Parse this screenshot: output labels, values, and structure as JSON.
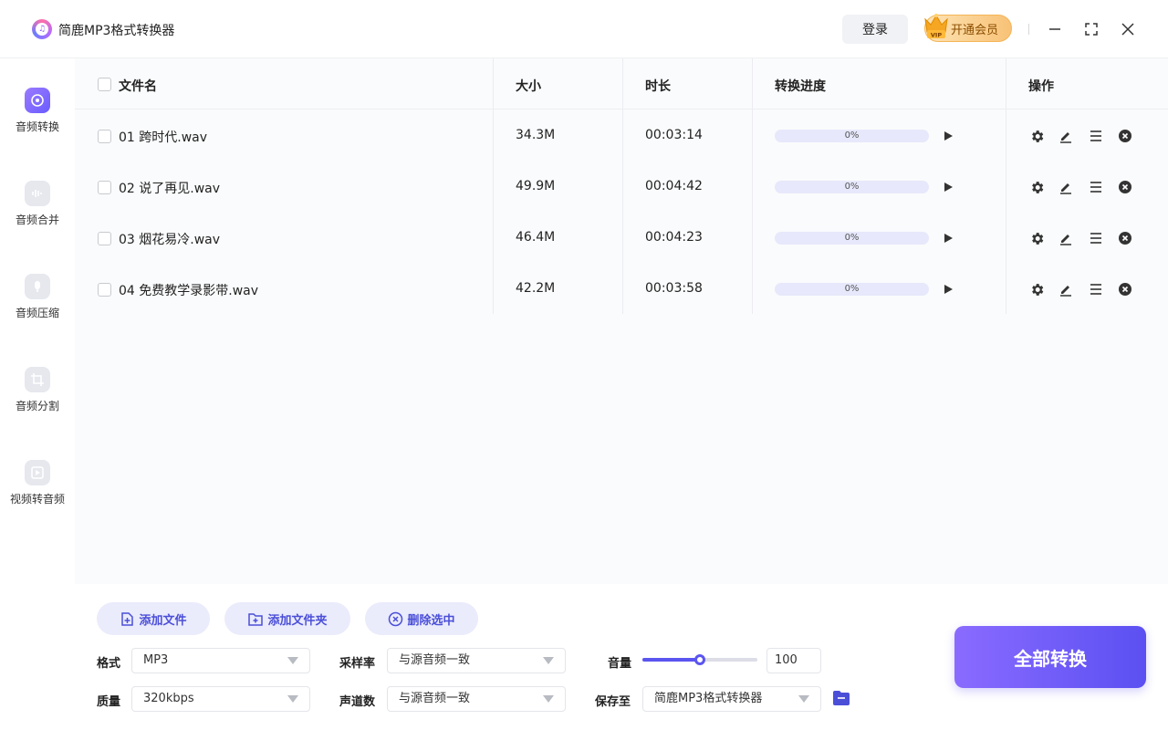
{
  "app": {
    "title": "简鹿MP3格式转换器"
  },
  "header": {
    "login_label": "登录",
    "vip_label": "开通会员",
    "vip_badge": "VIP"
  },
  "sidebar": {
    "items": [
      {
        "label": "音频转换",
        "icon": "audio-convert-icon",
        "active": true
      },
      {
        "label": "音频合并",
        "icon": "audio-merge-icon",
        "active": false
      },
      {
        "label": "音频压缩",
        "icon": "audio-compress-icon",
        "active": false
      },
      {
        "label": "音频分割",
        "icon": "audio-split-icon",
        "active": false
      },
      {
        "label": "视频转音频",
        "icon": "video-to-audio-icon",
        "active": false
      }
    ]
  },
  "table": {
    "headers": {
      "name": "文件名",
      "size": "大小",
      "duration": "时长",
      "progress": "转换进度",
      "actions": "操作"
    },
    "rows": [
      {
        "name": "01 跨时代.wav",
        "size": "34.3M",
        "duration": "00:03:14",
        "progress": "0%"
      },
      {
        "name": "02 说了再见.wav",
        "size": "49.9M",
        "duration": "00:04:42",
        "progress": "0%"
      },
      {
        "name": "03 烟花易冷.wav",
        "size": "46.4M",
        "duration": "00:04:23",
        "progress": "0%"
      },
      {
        "name": "04 免费教学录影带.wav",
        "size": "42.2M",
        "duration": "00:03:58",
        "progress": "0%"
      }
    ]
  },
  "toolbar": {
    "add_file": "添加文件",
    "add_folder": "添加文件夹",
    "delete_selected": "删除选中"
  },
  "settings": {
    "format_label": "格式",
    "format_value": "MP3",
    "quality_label": "质量",
    "quality_value": "320kbps",
    "samplerate_label": "采样率",
    "samplerate_value": "与源音频一致",
    "channels_label": "声道数",
    "channels_value": "与源音频一致",
    "volume_label": "音量",
    "volume_value": "100",
    "volume_fill": 0.5,
    "saveto_label": "保存至",
    "saveto_value": "简鹿MP3格式转换器"
  },
  "convert_all_label": "全部转换",
  "colors": {
    "accent": "#5b55f0",
    "accent_light": "#eaebfb",
    "vip": "#f8c277"
  }
}
